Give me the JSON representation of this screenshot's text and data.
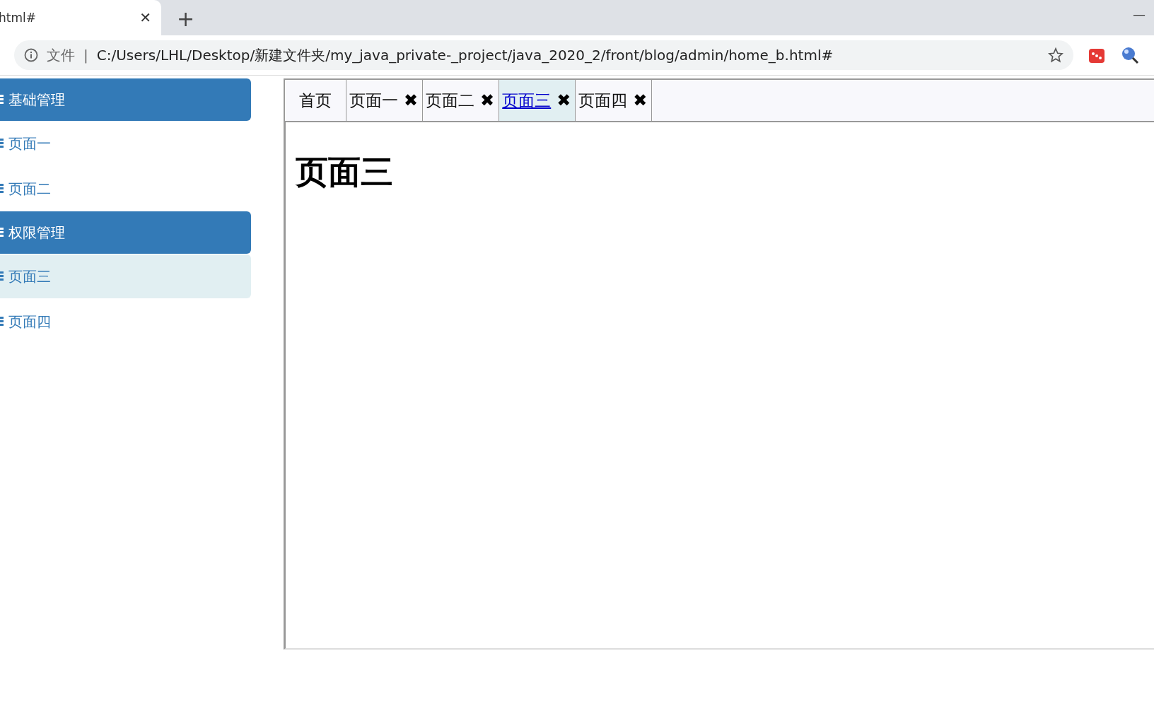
{
  "browser": {
    "tab_title": "html#",
    "tab_close": "✕",
    "new_tab": "+",
    "minimize": "—",
    "address_label": "文件",
    "address_separator": "|",
    "url": "C:/Users/LHL/Desktop/新建文件夹/my_java_private-_project/java_2020_2/front/blog/admin/home_b.html#"
  },
  "sidebar": {
    "groups": [
      {
        "title": "基础管理",
        "items": [
          {
            "label": "页面一",
            "selected": false
          },
          {
            "label": "页面二",
            "selected": false
          }
        ]
      },
      {
        "title": "权限管理",
        "items": [
          {
            "label": "页面三",
            "selected": true
          },
          {
            "label": "页面四",
            "selected": false
          }
        ]
      }
    ]
  },
  "tabs": [
    {
      "label": "首页",
      "selected": false
    },
    {
      "label": "页面一",
      "selected": false,
      "close": "✖"
    },
    {
      "label": "页面二",
      "selected": false,
      "close": "✖"
    },
    {
      "label": "页面三",
      "selected": true,
      "close": "✖"
    },
    {
      "label": "页面四",
      "selected": false,
      "close": "✖"
    }
  ],
  "content": {
    "heading": "页面三"
  }
}
